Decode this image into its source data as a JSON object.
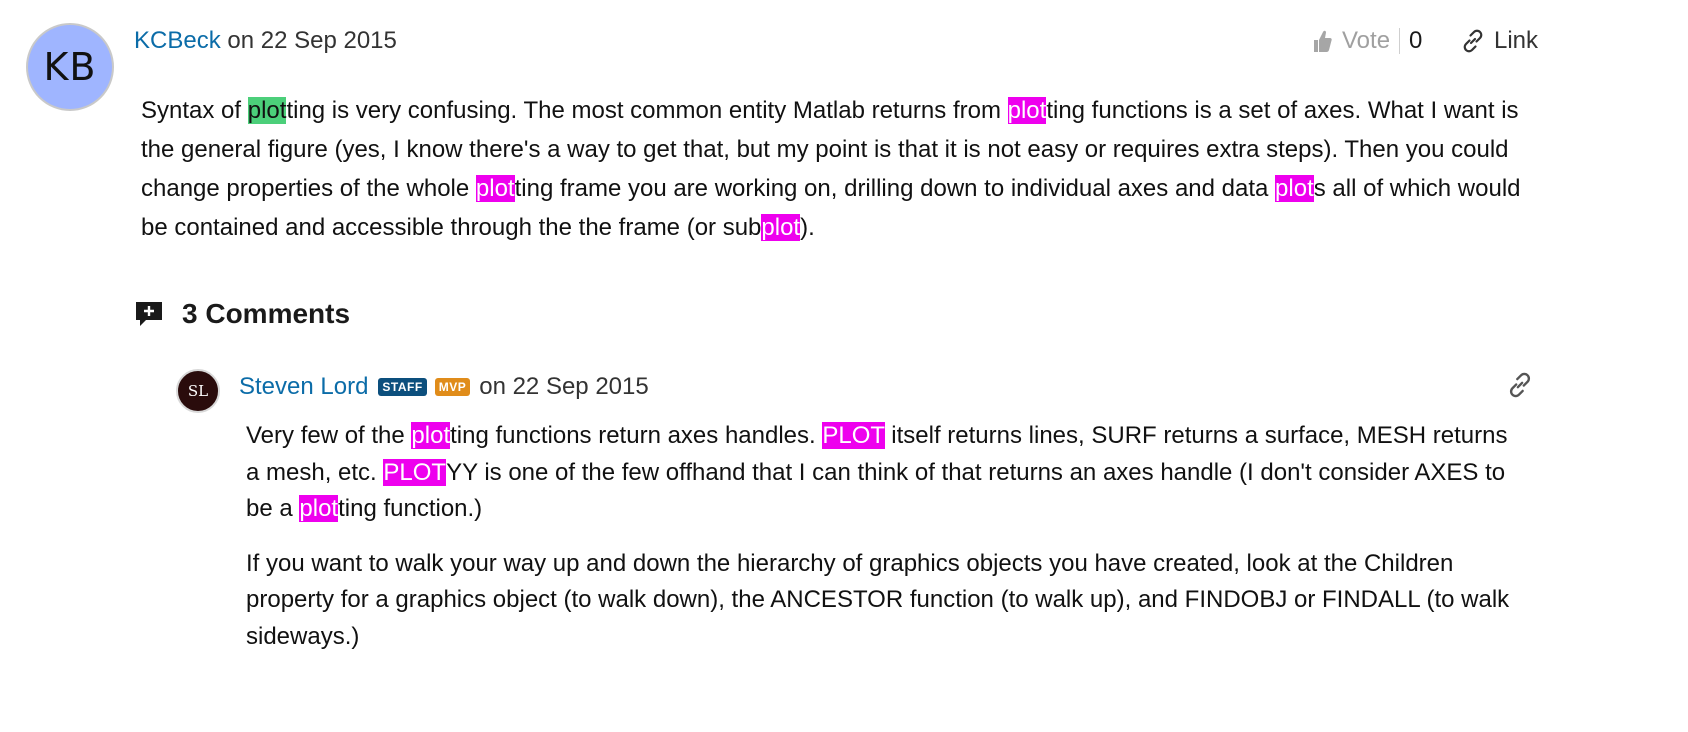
{
  "answer": {
    "avatar_initials": "KB",
    "author": "KCBeck",
    "date_text": "on 22 Sep 2015",
    "vote_label": "Vote",
    "vote_count": "0",
    "link_label": "Link",
    "body_segments": [
      {
        "t": "Syntax of "
      },
      {
        "t": "plot",
        "hl": "green"
      },
      {
        "t": "ting is very confusing. The most common entity Matlab returns from "
      },
      {
        "t": "plot",
        "hl": "magenta"
      },
      {
        "t": "ting functions is a set of axes. What I want is the general figure (yes, I know there's a way to get that, but my point is that it is not easy or requires extra steps). Then you could change properties of the whole "
      },
      {
        "t": "plot",
        "hl": "magenta"
      },
      {
        "t": "ting frame you are working on, drilling down to individual axes and data "
      },
      {
        "t": "plot",
        "hl": "magenta"
      },
      {
        "t": "s all of which would be contained and accessible through the the frame (or sub"
      },
      {
        "t": "plot",
        "hl": "magenta"
      },
      {
        "t": ")."
      }
    ]
  },
  "comments_section": {
    "title": "3 Comments"
  },
  "comment": {
    "avatar_initials": "SL",
    "author": "Steven Lord",
    "badge_staff": "STAFF",
    "badge_mvp": "MVP",
    "date_text": "on 22 Sep 2015",
    "paragraphs": [
      [
        {
          "t": "Very few of the "
        },
        {
          "t": "plot",
          "hl": "magenta"
        },
        {
          "t": "ting functions return axes handles. "
        },
        {
          "t": "PLOT",
          "hl": "magenta"
        },
        {
          "t": " itself returns lines, SURF returns a surface, MESH returns a mesh, etc. "
        },
        {
          "t": "PLOT",
          "hl": "magenta"
        },
        {
          "t": "YY is one of the few offhand that I can think of that returns an axes handle (I don't consider AXES to be a "
        },
        {
          "t": "plot",
          "hl": "magenta"
        },
        {
          "t": "ting function.)"
        }
      ],
      [
        {
          "t": "If you want to walk your way up and down the hierarchy of graphics objects you have created, look at the Children property for a graphics object (to walk down), the ANCESTOR function (to walk up), and FINDOBJ or FINDALL (to walk sideways.)"
        }
      ]
    ]
  },
  "colors": {
    "link": "#0b6ca8",
    "highlight_green": "#4ccf7a",
    "highlight_magenta": "#ee00ee",
    "badge_staff": "#0c4f7d",
    "badge_mvp": "#e08c1a",
    "avatar_kb": "#9fb5ff"
  },
  "icons": {
    "vote": "thumbs-up-icon",
    "link": "chain-link-icon",
    "comments": "add-comment-icon",
    "comment_permalink": "chain-link-icon"
  }
}
